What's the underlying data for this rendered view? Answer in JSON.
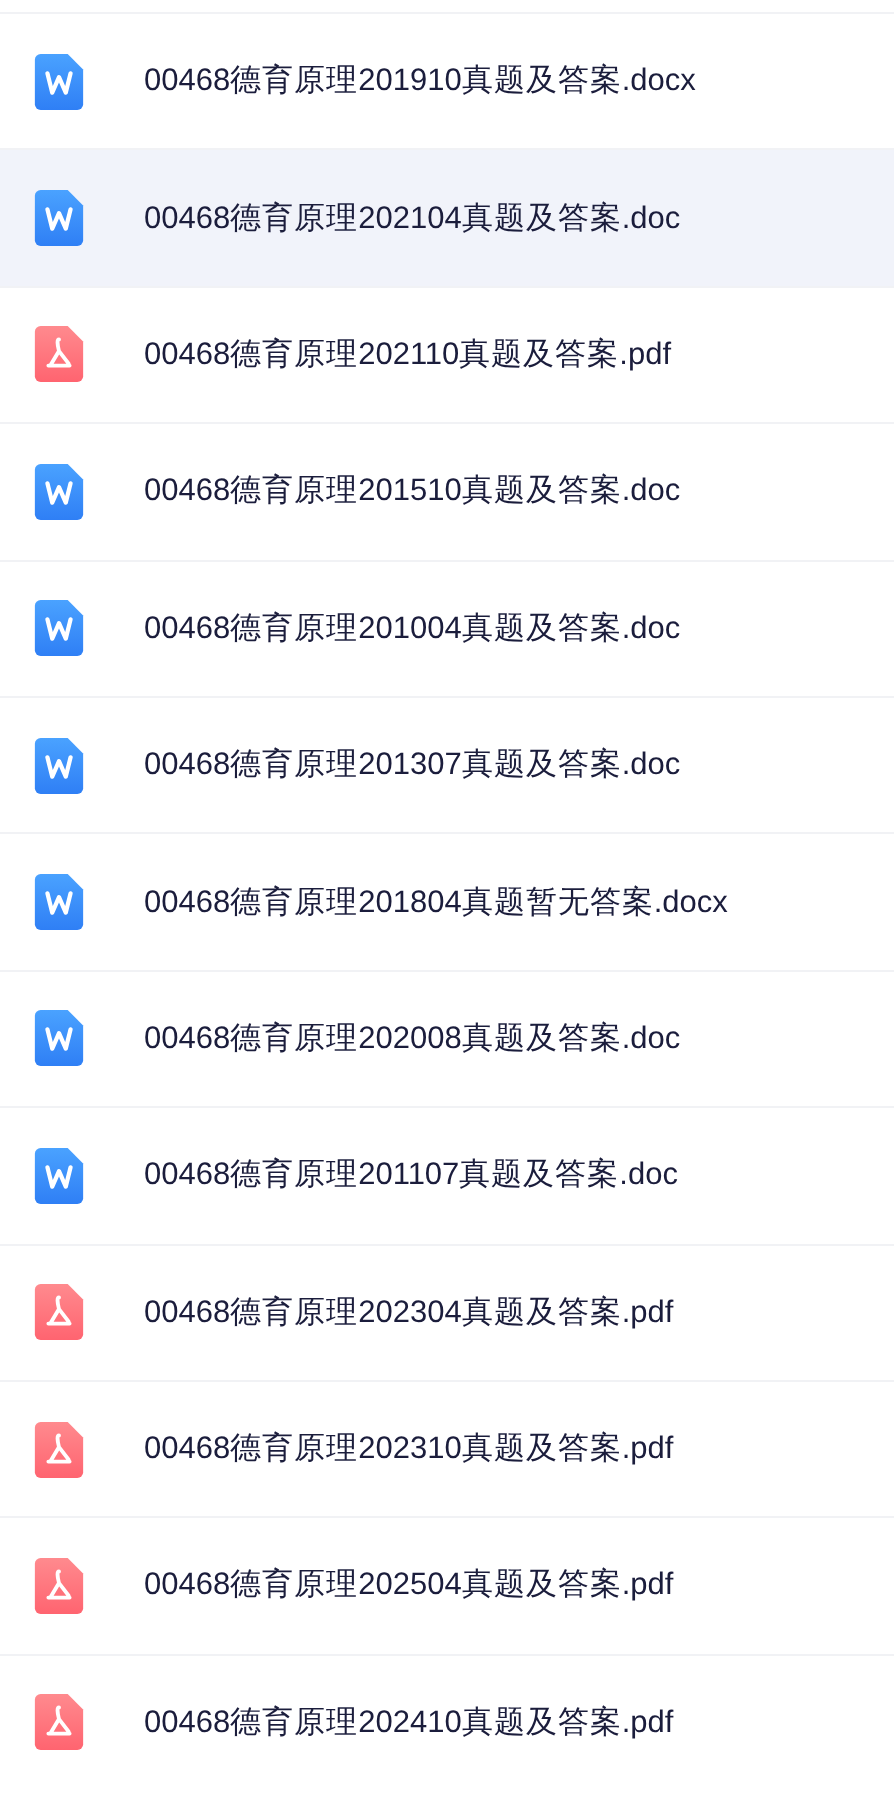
{
  "files": [
    {
      "kind": "word",
      "name": "00468德育原理201910真题及答案.docx",
      "selected": false
    },
    {
      "kind": "word",
      "name": "00468德育原理202104真题及答案.doc",
      "selected": true
    },
    {
      "kind": "pdf",
      "name": "00468德育原理202110真题及答案.pdf",
      "selected": false
    },
    {
      "kind": "word",
      "name": "00468德育原理201510真题及答案.doc",
      "selected": false
    },
    {
      "kind": "word",
      "name": "00468德育原理201004真题及答案.doc",
      "selected": false
    },
    {
      "kind": "word",
      "name": "00468德育原理201307真题及答案.doc",
      "selected": false
    },
    {
      "kind": "word",
      "name": "00468德育原理201804真题暂无答案.docx",
      "selected": false
    },
    {
      "kind": "word",
      "name": "00468德育原理202008真题及答案.doc",
      "selected": false
    },
    {
      "kind": "word",
      "name": "00468德育原理201107真题及答案.doc",
      "selected": false
    },
    {
      "kind": "pdf",
      "name": "00468德育原理202304真题及答案.pdf",
      "selected": false
    },
    {
      "kind": "pdf",
      "name": "00468德育原理202310真题及答案.pdf",
      "selected": false
    },
    {
      "kind": "pdf",
      "name": "00468德育原理202504真题及答案.pdf",
      "selected": false
    },
    {
      "kind": "pdf",
      "name": "00468德育原理202410真题及答案.pdf",
      "selected": false
    }
  ]
}
